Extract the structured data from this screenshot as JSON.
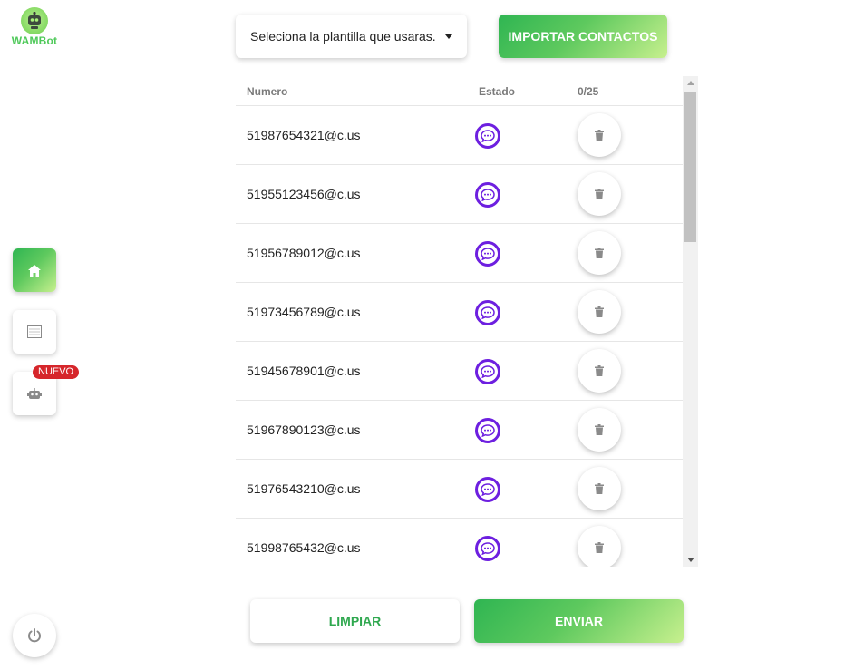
{
  "app": {
    "logo_text": "WAMBot"
  },
  "nav": {
    "items": [
      {
        "id": "home",
        "icon": "home-icon",
        "active": true
      },
      {
        "id": "templates",
        "icon": "template-icon",
        "active": false
      },
      {
        "id": "bot",
        "icon": "robot-icon",
        "active": false,
        "badge": "NUEVO"
      }
    ],
    "power_icon": "power-icon"
  },
  "toolbar": {
    "template_select_value": "Seleciona la plantilla que usaras.",
    "import_label": "IMPORTAR CONTACTOS"
  },
  "table": {
    "columns": {
      "numero": "Numero",
      "estado": "Estado",
      "count": "0/25"
    },
    "rows": [
      {
        "numero": "51987654321@c.us"
      },
      {
        "numero": "51955123456@c.us"
      },
      {
        "numero": "51956789012@c.us"
      },
      {
        "numero": "51973456789@c.us"
      },
      {
        "numero": "51945678901@c.us"
      },
      {
        "numero": "51967890123@c.us"
      },
      {
        "numero": "51976543210@c.us"
      },
      {
        "numero": "51998765432@c.us"
      }
    ]
  },
  "actions": {
    "clear_label": "LIMPIAR",
    "send_label": "ENVIAR"
  },
  "colors": {
    "accent_green": "#2fb552",
    "accent_light": "#c7f08e",
    "status_purple": "#6d1fe0",
    "badge_red": "#d6262b"
  }
}
